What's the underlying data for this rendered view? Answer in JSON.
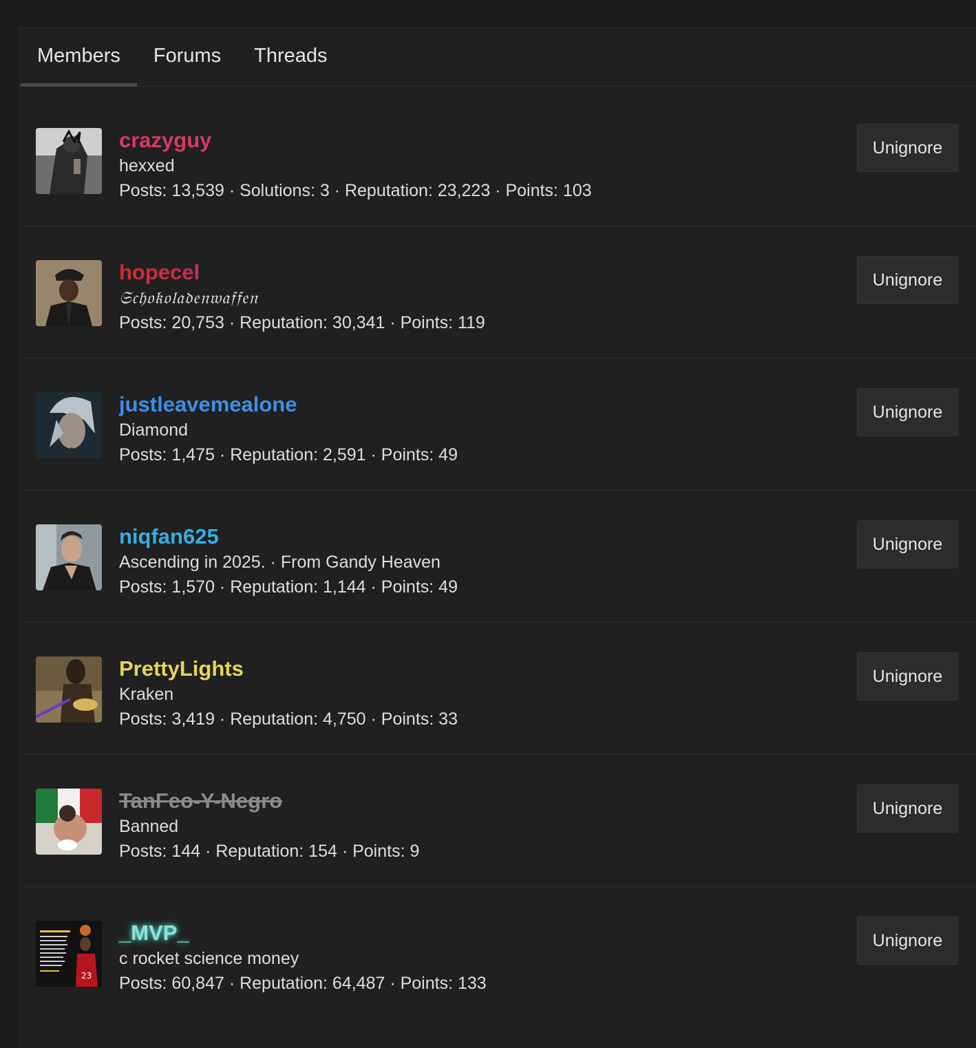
{
  "tabs": [
    {
      "label": "Members",
      "active": true
    },
    {
      "label": "Forums",
      "active": false
    },
    {
      "label": "Threads",
      "active": false
    }
  ],
  "members": [
    {
      "username": "crazyguy",
      "title": "hexxed",
      "stats": "Posts: 13,539 · Solutions: 3 · Reputation: 23,223 · Points: 103",
      "button": "Unignore",
      "color": "#d63a63"
    },
    {
      "username": "hopecel",
      "title": "𝔖𝔠𝔥𝔬𝔨𝔬𝔩𝔞𝔡𝔢𝔫𝔴𝔞𝔣𝔣𝔢𝔫",
      "stats": "Posts: 20,753 · Reputation: 30,341 · Points: 119",
      "button": "Unignore",
      "color": "gradient red-purple"
    },
    {
      "username": "justleavemealone",
      "title": "Diamond",
      "stats": "Posts: 1,475 · Reputation: 2,591 · Points: 49",
      "button": "Unignore",
      "color": "#3d8fe6"
    },
    {
      "username": "niqfan625",
      "title": "Ascending in 2025. · From Gandy Heaven",
      "stats": "Posts: 1,570 · Reputation: 1,144 · Points: 49",
      "button": "Unignore",
      "color": "#35aee0"
    },
    {
      "username": "PrettyLights",
      "title": "Kraken",
      "stats": "Posts: 3,419 · Reputation: 4,750 · Points: 33",
      "button": "Unignore",
      "color": "#e8d35a"
    },
    {
      "username": "TanFeo-Y-Negro",
      "title": "Banned",
      "stats": "Posts: 144 · Reputation: 154 · Points: 9",
      "button": "Unignore",
      "color": "#8a8a8a"
    },
    {
      "username": "_MVP_",
      "title": "c rocket science money",
      "stats": "Posts: 60,847 · Reputation: 64,487 · Points: 133",
      "button": "Unignore",
      "color": "#8fe0d8"
    }
  ]
}
